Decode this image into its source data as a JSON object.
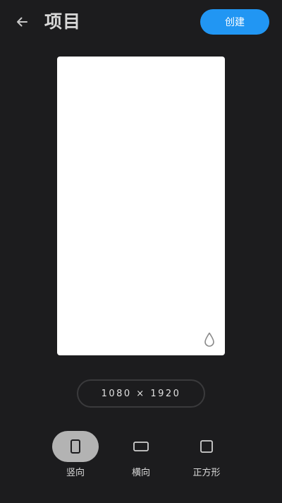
{
  "header": {
    "back_icon": "arrow-left-icon",
    "title": "项目",
    "create_label": "创建"
  },
  "canvas": {
    "watermark_icon": "drop-icon",
    "size_text": "1080 × 1920"
  },
  "orientations": [
    {
      "label": "竖向",
      "icon": "portrait-icon",
      "selected": true
    },
    {
      "label": "横向",
      "icon": "landscape-icon",
      "selected": false
    },
    {
      "label": "正方形",
      "icon": "square-icon",
      "selected": false
    }
  ],
  "colors": {
    "background": "#1c1c1e",
    "accent": "#2196f3",
    "selected_pill": "#b3b3b3"
  }
}
